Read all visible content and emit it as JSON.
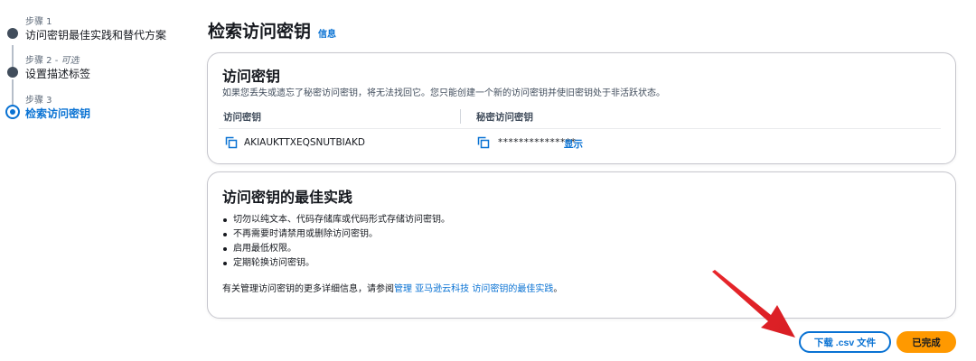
{
  "stepper": {
    "steps": [
      {
        "caption": "步骤 1",
        "optional": "",
        "title": "访问密钥最佳实践和替代方案",
        "state": "done"
      },
      {
        "caption": "步骤 2 - ",
        "optional": "可选",
        "title": "设置描述标签",
        "state": "done"
      },
      {
        "caption": "步骤 3",
        "optional": "",
        "title": "检索访问密钥",
        "state": "active"
      }
    ]
  },
  "header": {
    "title": "检索访问密钥",
    "info_link": "信息"
  },
  "access_key_card": {
    "title": "访问密钥",
    "description": "如果您丢失或遗忘了秘密访问密钥，将无法找回它。您只能创建一个新的访问密钥并使旧密钥处于非活跃状态。",
    "col_access_key": "访问密钥",
    "col_secret_key": "秘密访问密钥",
    "access_key_value": "AKIAUKTTXEQSNUTBIAKD",
    "secret_key_masked": "***************",
    "show_label": "显示"
  },
  "best_practices_card": {
    "title": "访问密钥的最佳实践",
    "items": [
      "切勿以纯文本、代码存储库或代码形式存储访问密钥。",
      "不再需要时请禁用或删除访问密钥。",
      "启用最低权限。",
      "定期轮换访问密钥。"
    ],
    "more_prefix": "有关管理访问密钥的更多详细信息，请参阅",
    "more_link": "管理 亚马逊云科技 访问密钥的最佳实践",
    "more_suffix": "。"
  },
  "footer": {
    "download_label": "下载 .csv 文件",
    "done_label": "已完成"
  },
  "colors": {
    "accent": "#0972d3",
    "primary_button": "#ff9900",
    "annotation_arrow": "#e8262b"
  },
  "icons": {
    "copy": "copy-icon"
  }
}
